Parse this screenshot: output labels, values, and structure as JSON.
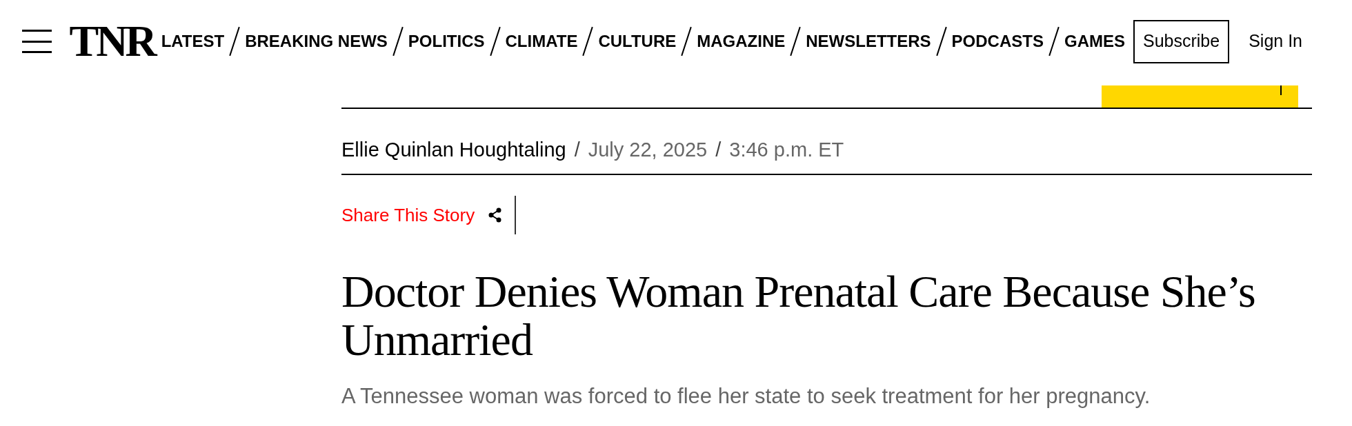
{
  "header": {
    "logo": "TNR",
    "nav": [
      "LATEST",
      "BREAKING NEWS",
      "POLITICS",
      "CLIMATE",
      "CULTURE",
      "MAGAZINE",
      "NEWSLETTERS",
      "PODCASTS",
      "GAMES"
    ],
    "subscribe": "Subscribe",
    "sign_in": "Sign In"
  },
  "byline": {
    "author": "Ellie Quinlan Houghtaling",
    "separators": [
      "/",
      "/"
    ],
    "date": "July 22, 2025",
    "time": "3:46 p.m. ET"
  },
  "share": {
    "label": "Share This Story"
  },
  "article": {
    "headline": "Doctor Denies Woman Prenatal Care Because She’s Unmarried",
    "dek": "A Tennessee woman was forced to flee her state to seek treatment for her pregnancy."
  }
}
